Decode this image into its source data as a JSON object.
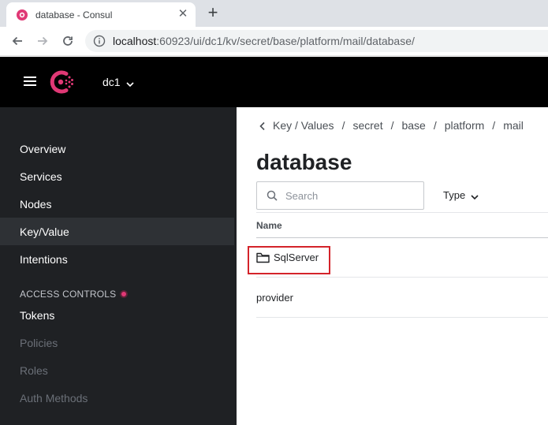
{
  "browser": {
    "tab_title": "database - Consul",
    "new_tab_label": "+",
    "tab_close_label": "✕",
    "url_host": "localhost",
    "url_path": ":60923/ui/dc1/kv/secret/base/platform/mail/database/",
    "icons": {
      "favicon": "consul-favicon-icon",
      "back": "arrow-left-icon",
      "forward": "arrow-right-icon",
      "reload": "reload-icon",
      "site_info": "info-circle-icon"
    }
  },
  "header": {
    "datacenter": "dc1",
    "icons": {
      "menu": "hamburger-icon",
      "logo": "consul-logo-icon",
      "dc_chevron": "chevron-down-icon"
    },
    "brand_color": "#e03875"
  },
  "sidebar": {
    "items": [
      {
        "label": "Overview",
        "state": "normal"
      },
      {
        "label": "Services",
        "state": "normal"
      },
      {
        "label": "Nodes",
        "state": "normal"
      },
      {
        "label": "Key/Value",
        "state": "active"
      },
      {
        "label": "Intentions",
        "state": "normal"
      }
    ],
    "access_controls": {
      "heading": "ACCESS CONTROLS",
      "items": [
        {
          "label": "Tokens",
          "state": "normal"
        },
        {
          "label": "Policies",
          "state": "disabled"
        },
        {
          "label": "Roles",
          "state": "disabled"
        },
        {
          "label": "Auth Methods",
          "state": "disabled"
        }
      ]
    }
  },
  "main": {
    "breadcrumb": [
      "Key / Values",
      "secret",
      "base",
      "platform",
      "mail"
    ],
    "breadcrumb_separator": "/",
    "title": "database",
    "search": {
      "placeholder": "Search",
      "value": ""
    },
    "type_filter": "Type",
    "column_header": "Name",
    "rows": [
      {
        "name": "SqlServer",
        "kind": "folder",
        "highlighted": true
      },
      {
        "name": "provider",
        "kind": "key",
        "highlighted": false
      }
    ],
    "highlight_color": "#d4232a"
  }
}
